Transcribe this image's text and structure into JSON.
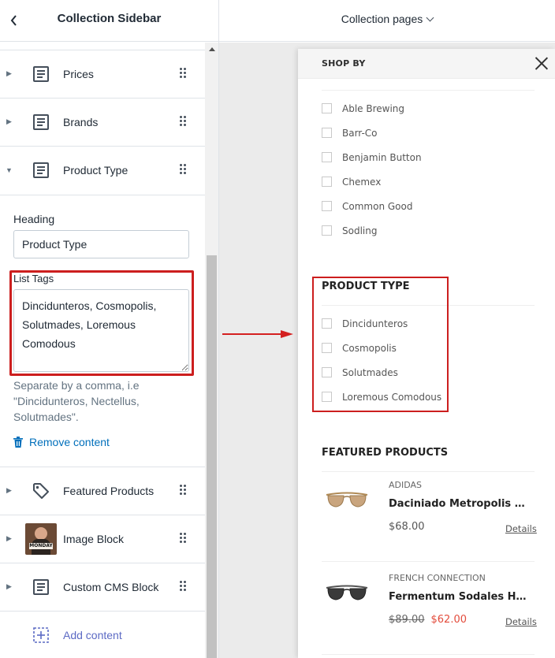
{
  "editor": {
    "title": "Collection Sidebar",
    "sections": [
      {
        "label": "Prices",
        "icon": "text-block-icon"
      },
      {
        "label": "Brands",
        "icon": "text-block-icon"
      },
      {
        "label": "Product Type",
        "icon": "text-block-icon"
      }
    ],
    "expanded": {
      "heading_label": "Heading",
      "heading_value": "Product Type",
      "tags_label": "List Tags",
      "tags_value": "Dincidunteros, Cosmopolis, Solutmades, Loremous Comodous",
      "helper": "Separate by a comma, i.e \"Dincidunteros, Nectellus, Solutmades\".",
      "remove_label": "Remove content"
    },
    "sections_after": [
      {
        "label": "Featured Products",
        "icon": "tag-icon"
      },
      {
        "label": "Image Block",
        "icon": "image-thumbnail"
      },
      {
        "label": "Custom CMS Block",
        "icon": "text-block-icon"
      }
    ],
    "add_content_label": "Add content",
    "thumbnail_text": "MONDAY"
  },
  "preview": {
    "page_selector": "Collection pages",
    "drawer_title": "SHOP BY",
    "brands": [
      "Able Brewing",
      "Barr-Co",
      "Benjamin Button",
      "Chemex",
      "Common Good",
      "Sodling"
    ],
    "product_type": {
      "title": "PRODUCT TYPE",
      "items": [
        "Dincidunteros",
        "Cosmopolis",
        "Solutmades",
        "Loremous Comodous"
      ]
    },
    "featured": {
      "title": "FEATURED PRODUCTS",
      "products": [
        {
          "brand": "ADIDAS",
          "name": "Daciniado Metropolis An...",
          "price": "$68.00",
          "details": "Details"
        },
        {
          "brand": "FRENCH CONNECTION",
          "name": "Fermentum Sodales Haugu...",
          "old_price": "$89.00",
          "sale_price": "$62.00",
          "details": "Details"
        }
      ]
    }
  },
  "colors": {
    "highlight": "#cc1e1e",
    "link": "#006fbb",
    "add_content": "#5c6ac4",
    "sale": "#e34c3c"
  }
}
